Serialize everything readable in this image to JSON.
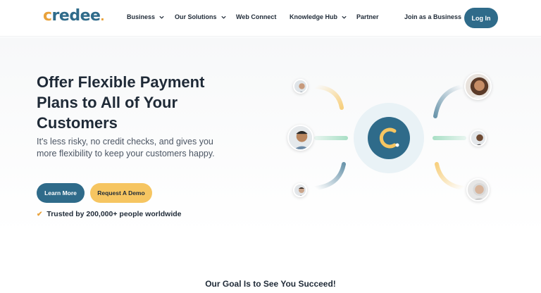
{
  "header": {
    "logo": {
      "first": "c",
      "rest": "redee",
      "dot": "."
    },
    "nav": [
      {
        "label": "Business",
        "dropdown": true
      },
      {
        "label": "Our Solutions",
        "dropdown": true
      },
      {
        "label": "Web Connect",
        "dropdown": false
      },
      {
        "label": "Knowledge Hub",
        "dropdown": true
      },
      {
        "label": "Partner",
        "dropdown": false
      }
    ],
    "join_label": "Join as a Business",
    "login_label": "Log In"
  },
  "hero": {
    "headline": "Offer Flexible Payment Plans to All of Your Customers",
    "subtext": "It's less risky, no credit checks, and gives you more flexibility to keep your customers happy.",
    "learn_more_label": "Learn More",
    "demo_label": "Request A Demo",
    "trusted_text": "Trusted by 200,000+ people worldwide"
  },
  "illustration": {
    "center_logo_letter": "c"
  },
  "footer_heading": "Our Goal Is to See You Succeed!",
  "colors": {
    "brand_blue": "#2f6b8a",
    "brand_yellow": "#f6c561",
    "accent_orange": "#e9a23b",
    "connector_green": "#9fdcbf"
  },
  "icons": [
    "chevron-down-icon",
    "check-icon",
    "avatar"
  ]
}
